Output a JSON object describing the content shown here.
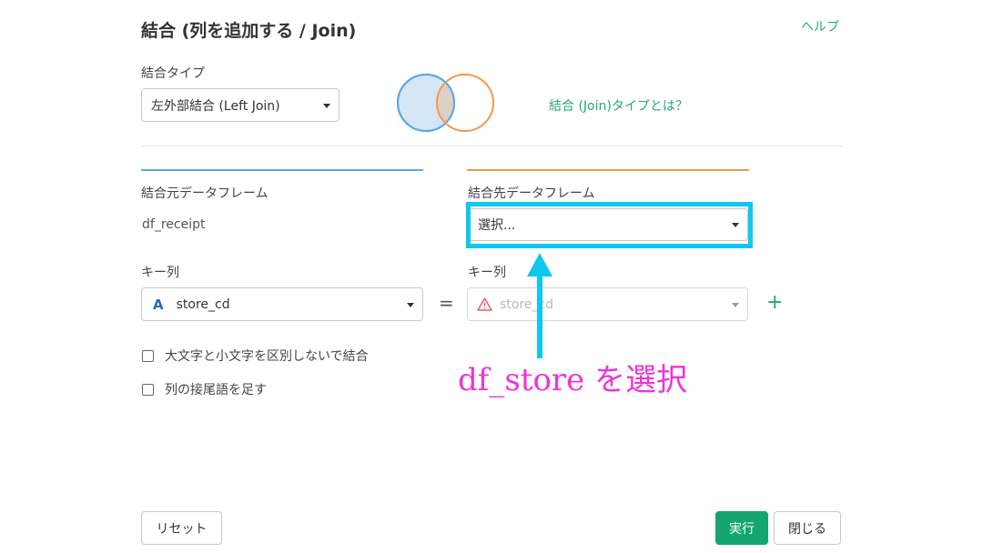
{
  "dialog": {
    "title": "結合 (列を追加する / Join)",
    "help_link": "ヘルプ"
  },
  "join_type": {
    "label": "結合タイプ",
    "selected": "左外部結合 (Left Join)",
    "info_link": "結合 (Join)タイプとは？",
    "venn_colors": {
      "left_fill": "#d6e6f7",
      "left_stroke": "#5aa6e6",
      "right_stroke": "#ee9a4c",
      "overlap_fill": "#ddd0c4"
    }
  },
  "source": {
    "label": "結合元データフレーム",
    "name": "df_receipt",
    "key_label": "キー列",
    "key_type_icon": "A",
    "key_value": "store_cd",
    "accent": "#5aa6e6"
  },
  "target": {
    "label": "結合先データフレーム",
    "select_placeholder": "選択...",
    "key_label": "キー列",
    "key_value": "store_cd",
    "accent": "#ee9a4c"
  },
  "operator": "=",
  "add_key": "+",
  "options": {
    "ignore_case": "大文字と小文字を区別しないで結合",
    "suffix": "列の接尾語を足す"
  },
  "annotation": {
    "text": "df_store を選択",
    "color": "#ee33d8",
    "highlight_color": "#0fc8ee"
  },
  "footer": {
    "reset": "リセット",
    "run": "実行",
    "close": "閉じる"
  }
}
